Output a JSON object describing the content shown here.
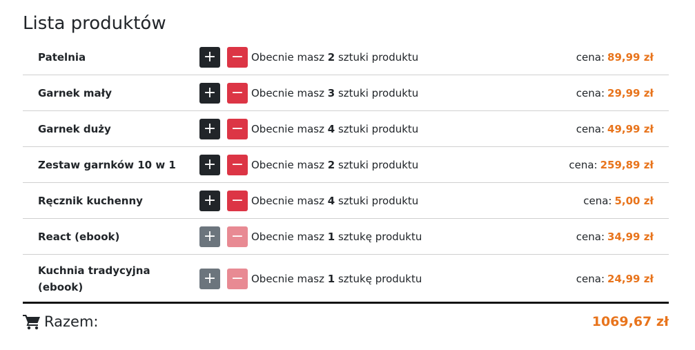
{
  "title": "Lista produktów",
  "labels": {
    "count_prefix": "Obecnie masz",
    "price_label": "cena:",
    "plus": "+",
    "minus": "−",
    "total_label": "Razem:"
  },
  "products": [
    {
      "name": "Patelnia",
      "qty": "2",
      "unit": "sztuki produktu",
      "price": "89,99 zł",
      "can_add": true,
      "can_remove": true
    },
    {
      "name": "Garnek mały",
      "qty": "3",
      "unit": "sztuki produktu",
      "price": "29,99 zł",
      "can_add": true,
      "can_remove": true
    },
    {
      "name": "Garnek duży",
      "qty": "4",
      "unit": "sztuki produktu",
      "price": "49,99 zł",
      "can_add": true,
      "can_remove": true
    },
    {
      "name": "Zestaw garnków 10 w 1",
      "qty": "2",
      "unit": "sztuki produktu",
      "price": "259,89 zł",
      "can_add": true,
      "can_remove": true
    },
    {
      "name": "Ręcznik kuchenny",
      "qty": "4",
      "unit": "sztuki produktu",
      "price": "5,00 zł",
      "can_add": true,
      "can_remove": true
    },
    {
      "name": "React (ebook)",
      "qty": "1",
      "unit": "sztukę produktu",
      "price": "34,99 zł",
      "can_add": false,
      "can_remove": false
    },
    {
      "name": "Kuchnia tradycyjna (ebook)",
      "qty": "1",
      "unit": "sztukę produktu",
      "price": "24,99 zł",
      "can_add": false,
      "can_remove": false
    }
  ],
  "total": {
    "value": "1069,67 zł",
    "icon": "shopping-cart-icon"
  },
  "colors": {
    "accent": "#e8741c",
    "plus_button": "#212529",
    "minus_button": "#dc3545"
  }
}
